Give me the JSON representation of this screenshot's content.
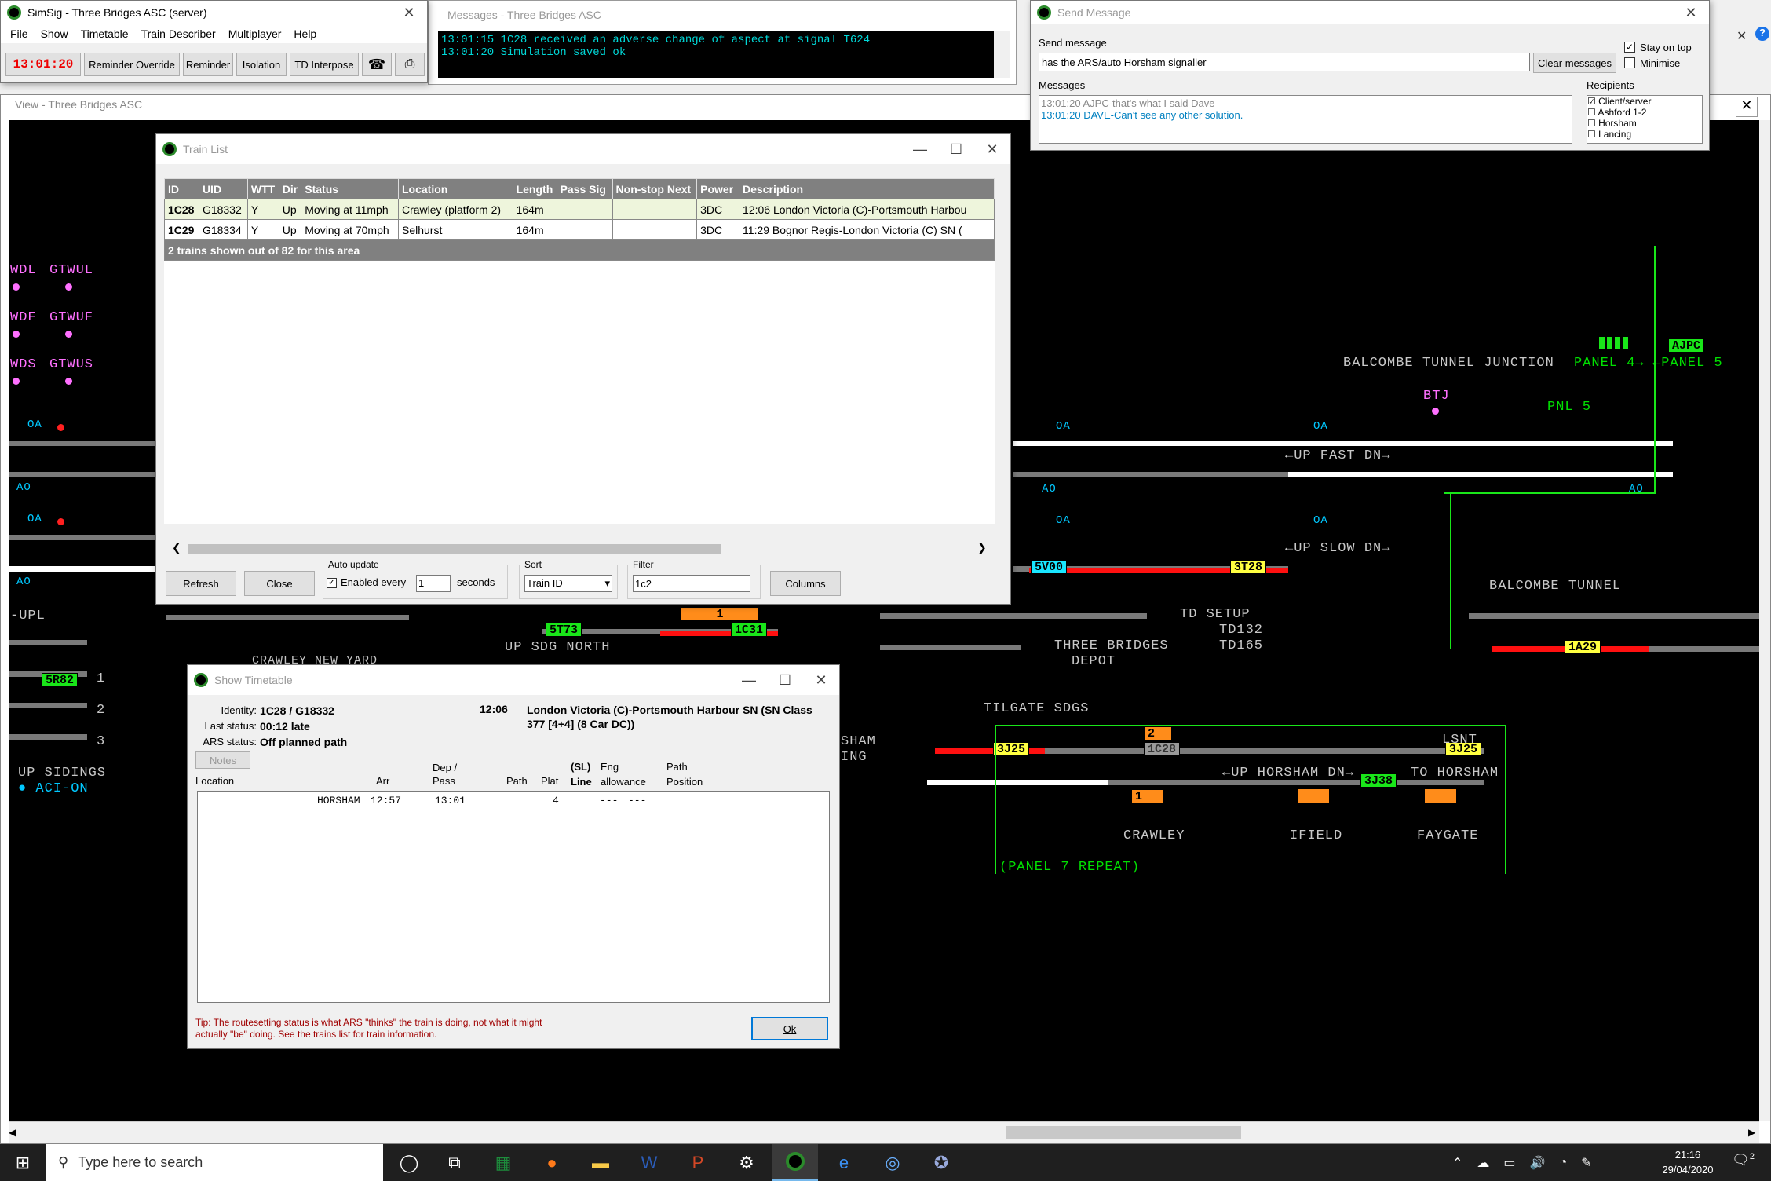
{
  "simsig": {
    "title": "SimSig - Three Bridges ASC (server)",
    "menu": [
      "File",
      "Show",
      "Timetable",
      "Train Describer",
      "Multiplayer",
      "Help"
    ],
    "clock": "13:01:20",
    "buttons": [
      "Reminder Override",
      "Reminder",
      "Isolation",
      "TD Interpose"
    ]
  },
  "messages": {
    "title": "Messages - Three Bridges ASC",
    "lines": [
      "13:01:15 1C28 received an adverse change of aspect at signal T624",
      "13:01:20 Simulation saved ok"
    ]
  },
  "send": {
    "title": "Send Message",
    "label": "Send message",
    "input": "has the ARS/auto Horsham signaller",
    "clear": "Clear messages",
    "stay": "Stay on top",
    "minimise": "Minimise",
    "msgs_label": "Messages",
    "msgs": [
      "13:01:20 AJPC-that's what I said Dave",
      "13:01:20 DAVE-Can't see any other solution."
    ],
    "recipients_label": "Recipients",
    "recipients": [
      "Client/server",
      "Ashford 1-2",
      "Horsham",
      "Lancing"
    ]
  },
  "view": {
    "title": "View - Three Bridges ASC"
  },
  "trainlist": {
    "title": "Train List",
    "columns": [
      "ID",
      "UID",
      "WTT",
      "Dir",
      "Status",
      "Location",
      "Length",
      "Pass Sig",
      "Non-stop Next",
      "Power",
      "Description"
    ],
    "rows": [
      [
        "1C28",
        "G18332",
        "Y",
        "Up",
        "Moving at 11mph",
        "Crawley (platform 2)",
        "164m",
        "",
        "",
        "3DC",
        "12:06 London Victoria (C)-Portsmouth Harbou"
      ],
      [
        "1C29",
        "G18334",
        "Y",
        "Up",
        "Moving at 70mph",
        "Selhurst",
        "164m",
        "",
        "",
        "3DC",
        "11:29 Bognor Regis-London Victoria (C) SN ("
      ]
    ],
    "footer": "2 trains shown out of 82 for this area",
    "refresh": "Refresh",
    "close": "Close",
    "auto_label": "Auto update",
    "enabled": "Enabled every",
    "every_val": "1",
    "seconds": "seconds",
    "sort_label": "Sort",
    "sort_val": "Train ID",
    "filter_label": "Filter",
    "filter_val": "1c2",
    "columns_btn": "Columns"
  },
  "timetable": {
    "title": "Show Timetable",
    "identity_l": "Identity:",
    "identity": "1C28 / G18332",
    "last_l": "Last status:",
    "last": "00:12  late",
    "ars_l": "ARS status:",
    "ars": "Off planned path",
    "desc_time": "12:06",
    "desc": "London Victoria (C)-Portsmouth Harbour SN (SN Class 377 [4+4] (8 Car DC))",
    "notes": "Notes",
    "h_location": "Location",
    "h_arr": "Arr",
    "h_dep": "Dep /\nPass",
    "h_path": "Path",
    "h_plat": "Plat",
    "h_line": "(SL)\nLine",
    "h_eng": "Eng\nallowance",
    "h_pathpos": "Path\nPosition",
    "row": {
      "loc": "HORSHAM",
      "arr": "12:57",
      "dep": "13:01",
      "plat": "4",
      "eng": "---",
      "pos": "---"
    },
    "tip": "Tip: The routesetting status is what ARS \"thinks\" the train is doing, not what it might actually \"be\" doing. See the trains list for train information.",
    "ok": "Ok"
  },
  "diagram": {
    "labels": [
      {
        "t": "WDL",
        "c": "pink"
      },
      {
        "t": "GTWUL",
        "c": "pink"
      },
      {
        "t": "WDF",
        "c": "pink"
      },
      {
        "t": "GTWUF",
        "c": "pink"
      },
      {
        "t": "WDS",
        "c": "pink"
      },
      {
        "t": "GTWUS",
        "c": "pink"
      },
      {
        "t": "BALCOMBE TUNNEL JUNCTION",
        "c": ""
      },
      {
        "t": "PANEL 4→",
        "c": "green"
      },
      {
        "t": "←PANEL 5",
        "c": "green"
      },
      {
        "t": "AJPC",
        "c": "green"
      },
      {
        "t": "BTJ",
        "c": "pink"
      },
      {
        "t": "←UP FAST DN→",
        "c": ""
      },
      {
        "t": "←UP SLOW DN→",
        "c": ""
      },
      {
        "t": "BALCOMBE TUNNEL",
        "c": ""
      },
      {
        "t": "TD SETUP",
        "c": ""
      },
      {
        "t": "TD132",
        "c": ""
      },
      {
        "t": "TD165",
        "c": ""
      },
      {
        "t": "THREE BRIDGES",
        "c": ""
      },
      {
        "t": "DEPOT",
        "c": ""
      },
      {
        "t": "TILGATE SDGS",
        "c": ""
      },
      {
        "t": "UP SDG NORTH",
        "c": ""
      },
      {
        "t": "CRAWLEY NEW YARD",
        "c": ""
      },
      {
        "t": "UP SIDINGS",
        "c": ""
      },
      {
        "t": "ACI-ON",
        "c": "cyan"
      },
      {
        "t": "←UP HORSHAM DN→",
        "c": ""
      },
      {
        "t": "LSNT",
        "c": ""
      },
      {
        "t": "TO HORSHAM",
        "c": ""
      },
      {
        "t": "CRAWLEY",
        "c": ""
      },
      {
        "t": "IFIELD",
        "c": ""
      },
      {
        "t": "FAYGATE",
        "c": ""
      },
      {
        "t": "(PANEL 7 REPEAT)",
        "c": "green"
      },
      {
        "t": "PNL 5",
        "c": "green"
      },
      {
        "t": "-UPL",
        "c": ""
      },
      {
        "t": "SHAM",
        "c": ""
      },
      {
        "t": "ING",
        "c": ""
      },
      {
        "t": "1",
        "c": ""
      },
      {
        "t": "2",
        "c": ""
      },
      {
        "t": "3",
        "c": ""
      }
    ],
    "berths": [
      "5R82",
      "5V00",
      "3T28",
      "5T73",
      "1C31",
      "1",
      "3J25",
      "1C28",
      "2",
      "3J25",
      "3J38",
      "1",
      "1A29"
    ]
  },
  "taskbar": {
    "search": "Type here to search",
    "time": "21:16",
    "date": "29/04/2020",
    "badge": "2"
  },
  "colors": {
    "track": "#7a7a7a",
    "route_set": "#ffffff",
    "occupied": "#ff1010",
    "berth_yellow": "#ffff40",
    "berth_green": "#19e619"
  }
}
